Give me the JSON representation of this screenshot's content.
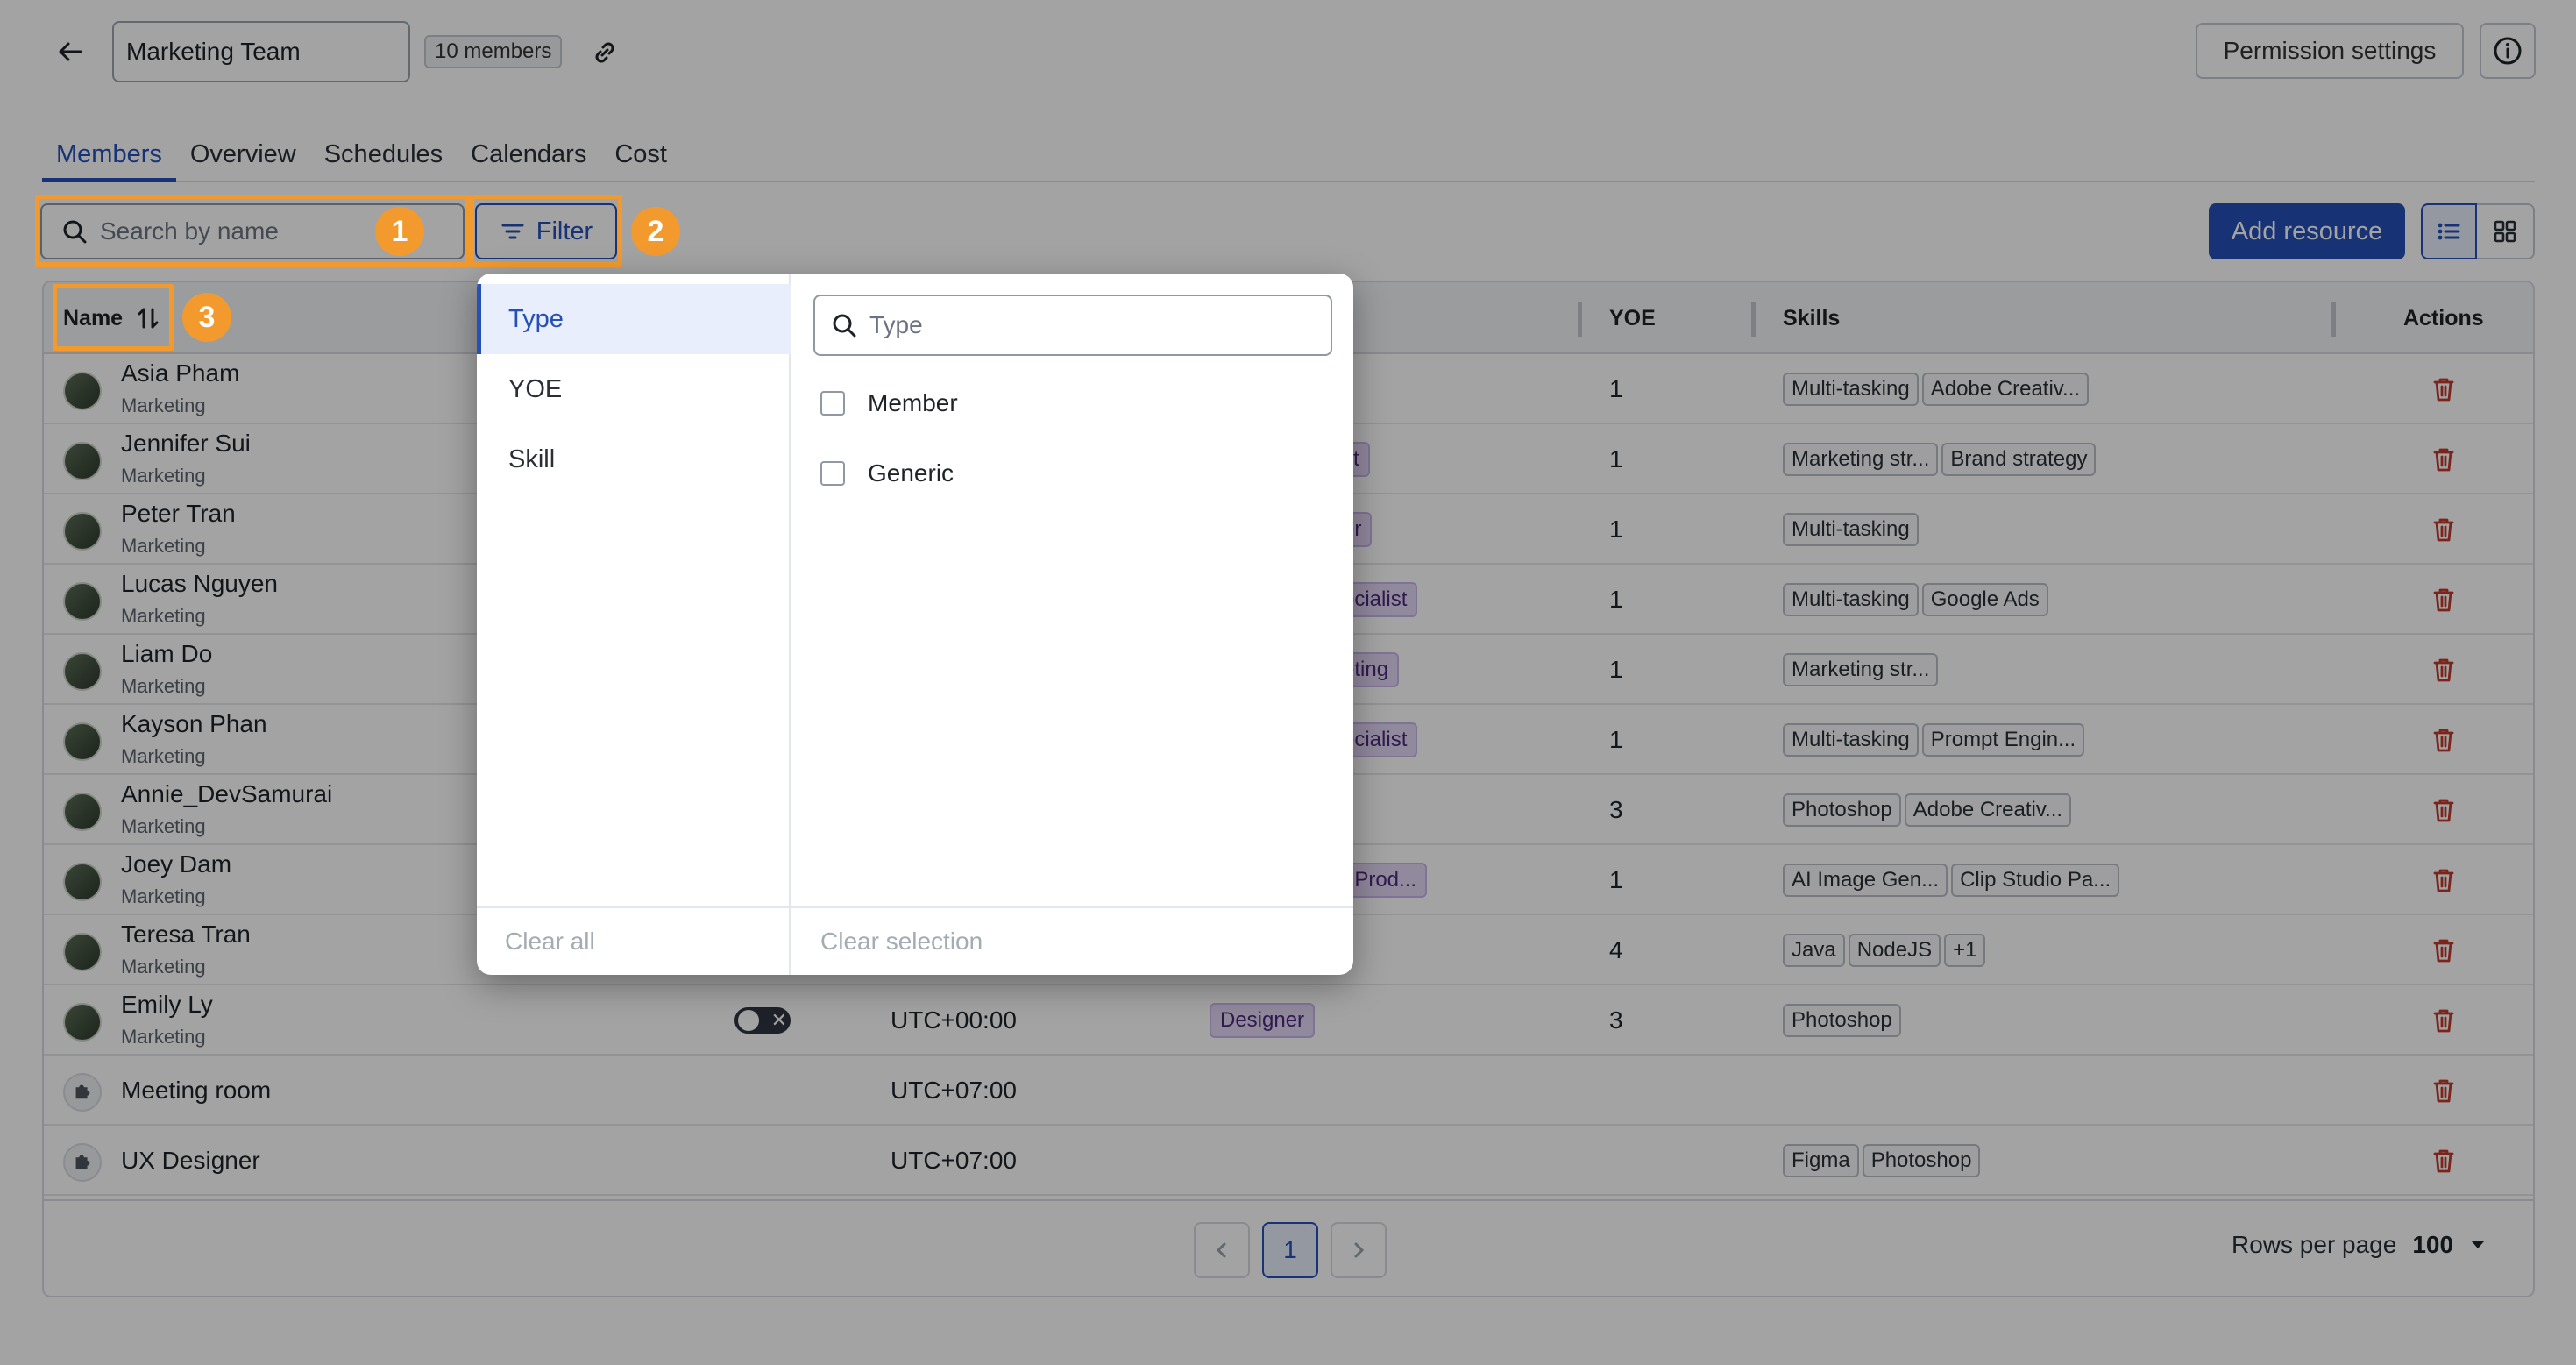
{
  "header": {
    "team_name": "Marketing Team",
    "member_count": "10 members",
    "permission_label": "Permission settings"
  },
  "tabs": [
    {
      "label": "Members",
      "active": true
    },
    {
      "label": "Overview"
    },
    {
      "label": "Schedules"
    },
    {
      "label": "Calendars"
    },
    {
      "label": "Cost"
    }
  ],
  "toolbar": {
    "search_placeholder": "Search by name",
    "filter_label": "Filter",
    "add_label": "Add resource"
  },
  "annotations": [
    "1",
    "2",
    "3"
  ],
  "table": {
    "headers": {
      "name": "Name",
      "yoe": "YOE",
      "skills": "Skills",
      "actions": "Actions"
    },
    "rows": [
      {
        "name": "Asia Pham",
        "dept": "Marketing",
        "timezone": "",
        "role": "",
        "yoe": "1",
        "skills": [
          "Multi-tasking",
          "Adobe Creativ..."
        ]
      },
      {
        "name": "Jennifer Sui",
        "dept": "Marketing",
        "timezone": "",
        "role": "st",
        "yoe": "1",
        "skills": [
          "Marketing str...",
          "Brand strategy"
        ]
      },
      {
        "name": "Peter Tran",
        "dept": "Marketing",
        "timezone": "",
        "role": "er",
        "yoe": "1",
        "skills": [
          "Multi-tasking"
        ]
      },
      {
        "name": "Lucas Nguyen",
        "dept": "Marketing",
        "timezone": "",
        "role": "ecialist",
        "yoe": "1",
        "skills": [
          "Multi-tasking",
          "Google Ads"
        ]
      },
      {
        "name": "Liam Do",
        "dept": "Marketing",
        "timezone": "",
        "role": "eting",
        "yoe": "1",
        "skills": [
          "Marketing str..."
        ]
      },
      {
        "name": "Kayson Phan",
        "dept": "Marketing",
        "timezone": "",
        "role": "ecialist",
        "yoe": "1",
        "skills": [
          "Multi-tasking",
          "Prompt Engin..."
        ]
      },
      {
        "name": "Annie_DevSamurai",
        "dept": "Marketing",
        "timezone": "",
        "role": "",
        "yoe": "3",
        "skills": [
          "Photoshop",
          "Adobe Creativ..."
        ]
      },
      {
        "name": "Joey Dam",
        "dept": "Marketing",
        "timezone": "",
        "role": "t Prod...",
        "yoe": "1",
        "skills": [
          "AI Image Gen...",
          "Clip Studio Pa..."
        ]
      },
      {
        "name": "Teresa Tran",
        "dept": "Marketing",
        "timezone": "",
        "role": "",
        "yoe": "4",
        "skills": [
          "Java",
          "NodeJS",
          "+1"
        ]
      },
      {
        "name": "Emily Ly",
        "dept": "Marketing",
        "timezone": "UTC+00:00",
        "role": "Designer",
        "yoe": "3",
        "skills": [
          "Photoshop"
        ]
      },
      {
        "name": "Meeting room",
        "dept": "",
        "timezone": "UTC+07:00",
        "role": "",
        "yoe": "",
        "skills": []
      },
      {
        "name": "UX Designer",
        "dept": "",
        "timezone": "UTC+07:00",
        "role": "",
        "yoe": "",
        "skills": [
          "Figma",
          "Photoshop"
        ]
      }
    ]
  },
  "pagination": {
    "current_page": "1",
    "rows_per_page_label": "Rows per page",
    "rows_per_page_value": "100"
  },
  "filter_panel": {
    "categories": [
      "Type",
      "YOE",
      "Skill"
    ],
    "active_category": "Type",
    "search_placeholder": "Type",
    "options": [
      "Member",
      "Generic"
    ],
    "clear_all": "Clear all",
    "clear_selection": "Clear selection"
  },
  "colors": {
    "accent": "#2450b8",
    "annotation": "#f39a2e",
    "danger": "#c0392b"
  }
}
